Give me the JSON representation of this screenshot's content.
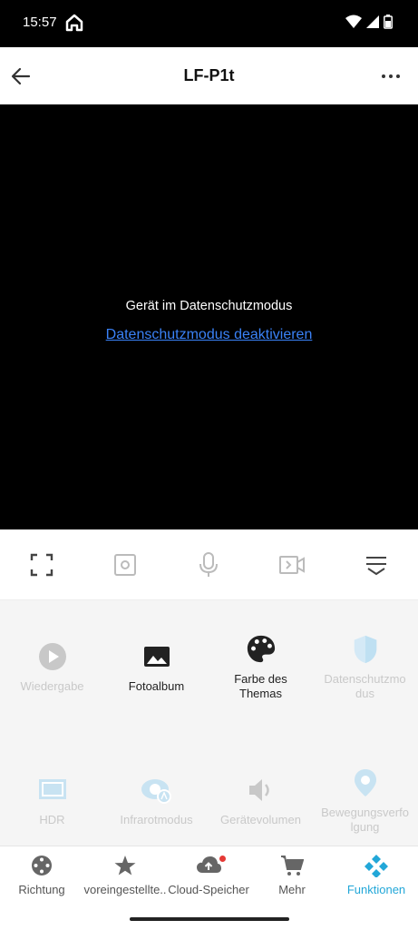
{
  "status": {
    "time": "15:57"
  },
  "header": {
    "title": "LF-P1t"
  },
  "video": {
    "message": "Gerät im Datenschutzmodus",
    "link": "Datenschutzmodus deaktivieren"
  },
  "features": [
    {
      "label": "Wiedergabe",
      "enabled": false
    },
    {
      "label": "Fotoalbum",
      "enabled": true
    },
    {
      "label": "Farbe des Themas",
      "enabled": true
    },
    {
      "label": "Datenschutzmodus",
      "enabled": false
    },
    {
      "label": "HDR",
      "enabled": false
    },
    {
      "label": "Infrarotmodus",
      "enabled": false
    },
    {
      "label": "Gerätevolumen",
      "enabled": false
    },
    {
      "label": "Bewegungsverfolgung",
      "enabled": false
    }
  ],
  "tabs": [
    {
      "label": "Richtung"
    },
    {
      "label": "voreingestellte.."
    },
    {
      "label": "Cloud-Speicher"
    },
    {
      "label": "Mehr"
    },
    {
      "label": "Funktionen",
      "active": true
    }
  ],
  "colors": {
    "accent": "#22a7d8",
    "link": "#3a82f7",
    "disabled_icon": "#c8e3f2"
  }
}
